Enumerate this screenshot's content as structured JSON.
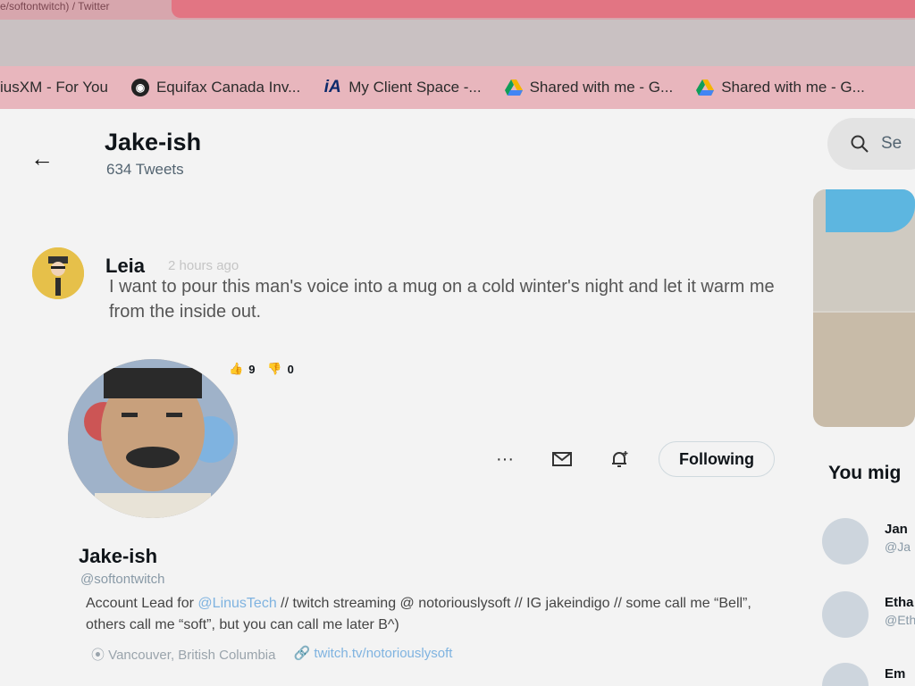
{
  "browser": {
    "tab_title": "e/softontwitch) / Twitter",
    "bookmarks": [
      {
        "label": "iusXM - For You",
        "icon": "none"
      },
      {
        "label": "Equifax Canada Inv...",
        "icon": "globe-icon"
      },
      {
        "label": "My Client Space -...",
        "icon": "ia-icon"
      },
      {
        "label": "Shared with me - G...",
        "icon": "google-drive-icon"
      },
      {
        "label": "Shared with me - G...",
        "icon": "google-drive-icon"
      }
    ]
  },
  "header": {
    "title": "Jake-ish",
    "tweet_count": "634 Tweets",
    "back_icon": "←"
  },
  "comment": {
    "author": "Leia",
    "time": "2 hours ago",
    "text": "I want to pour this man's voice into a mug on a cold winter's night and let it warm me from the inside out.",
    "likes": "9",
    "dislikes": "0"
  },
  "profile": {
    "name": "Jake-ish",
    "handle": "@softontwitch",
    "follow_label": "Following",
    "more_label": "···",
    "bio_prefix": "Account Lead for ",
    "bio_mention": "@LinusTech",
    "bio_rest": " // twitch streaming @ notoriouslysoft // IG jakeindigo // some call me “Bell”, others call me “soft”, but you can call me later B^)",
    "location": "Vancouver, British Columbia",
    "website": "twitch.tv/notoriouslysoft"
  },
  "sidebar": {
    "search_placeholder": "Se",
    "who_to_follow_title": "You mig",
    "suggestions": [
      {
        "name": "Jan",
        "handle": "@Ja"
      },
      {
        "name": "Etha",
        "handle": "@Eth"
      },
      {
        "name": "Em",
        "handle": ""
      }
    ]
  },
  "colors": {
    "tab_strip": "#d7a6ad",
    "active_tab": "#e27583",
    "bookmarks_bar": "#e8b6bd",
    "link": "#7fb3e0"
  }
}
